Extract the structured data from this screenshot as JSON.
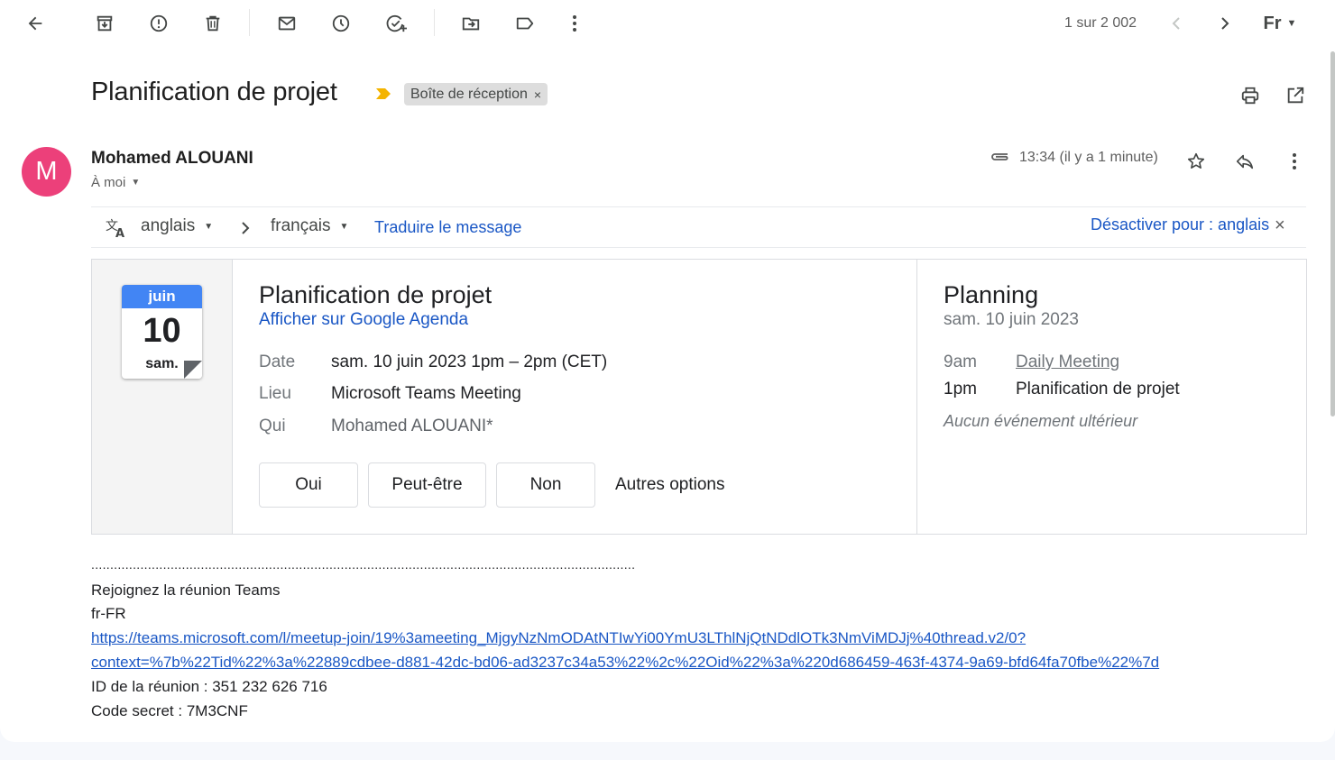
{
  "toolbar": {
    "pagination": "1 sur 2 002",
    "input_tool": "Fr"
  },
  "message": {
    "subject": "Planification de projet",
    "label": "Boîte de réception",
    "label_remove": "×",
    "sender_initial": "M",
    "sender_name": "Mohamed ALOUANI",
    "recipient": "À moi",
    "time": "13:34 (il y a 1 minute)"
  },
  "translate": {
    "source_lang": "anglais",
    "target_lang": "français",
    "translate_link": "Traduire le message",
    "disable_link": "Désactiver pour : anglais",
    "close": "×"
  },
  "invite": {
    "calendar_icon": {
      "month": "juin",
      "day": "10",
      "weekday": "sam."
    },
    "title": "Planification de projet",
    "gcal_link": "Afficher sur Google Agenda",
    "rows": [
      {
        "label": "Date",
        "value": "sam. 10 juin 2023 1pm – 2pm (CET)"
      },
      {
        "label": "Lieu",
        "value": "Microsoft Teams Meeting"
      },
      {
        "label": "Qui",
        "value": "Mohamed ALOUANI*"
      }
    ],
    "rsvp": {
      "yes": "Oui",
      "maybe": "Peut-être",
      "no": "Non",
      "more": "Autres options"
    }
  },
  "agenda": {
    "title": "Planning",
    "date": "sam. 10 juin 2023",
    "events": [
      {
        "time": "9am",
        "name": "Daily Meeting"
      },
      {
        "time": "1pm",
        "name": "Planification de projet"
      }
    ],
    "footer": "Aucun événement ultérieur"
  },
  "body": {
    "dots": "................................................................................................................................................",
    "join_text": "Rejoignez la réunion Teams",
    "locale": "fr-FR",
    "link_line1": "https://teams.microsoft.com/l/meetup-join/19%3ameeting_MjgyNzNmODAtNTIwYi00YmU3LThlNjQtNDdlOTk3NmViMDJj%40thread.v2/0?",
    "link_line2": "context=%7b%22Tid%22%3a%22889cdbee-d881-42dc-bd06-ad3237c34a53%22%2c%22Oid%22%3a%220d686459-463f-4374-9a69-bfd64fa70fbe%22%7d",
    "meeting_id": "ID de la réunion : 351 232 626 716",
    "passcode": "Code secret : 7M3CNF"
  },
  "colors": {
    "avatar": "#ec407a",
    "link": "#1a57c5",
    "calendar_header": "#4285f4",
    "importance_marker": "#f4b400"
  }
}
